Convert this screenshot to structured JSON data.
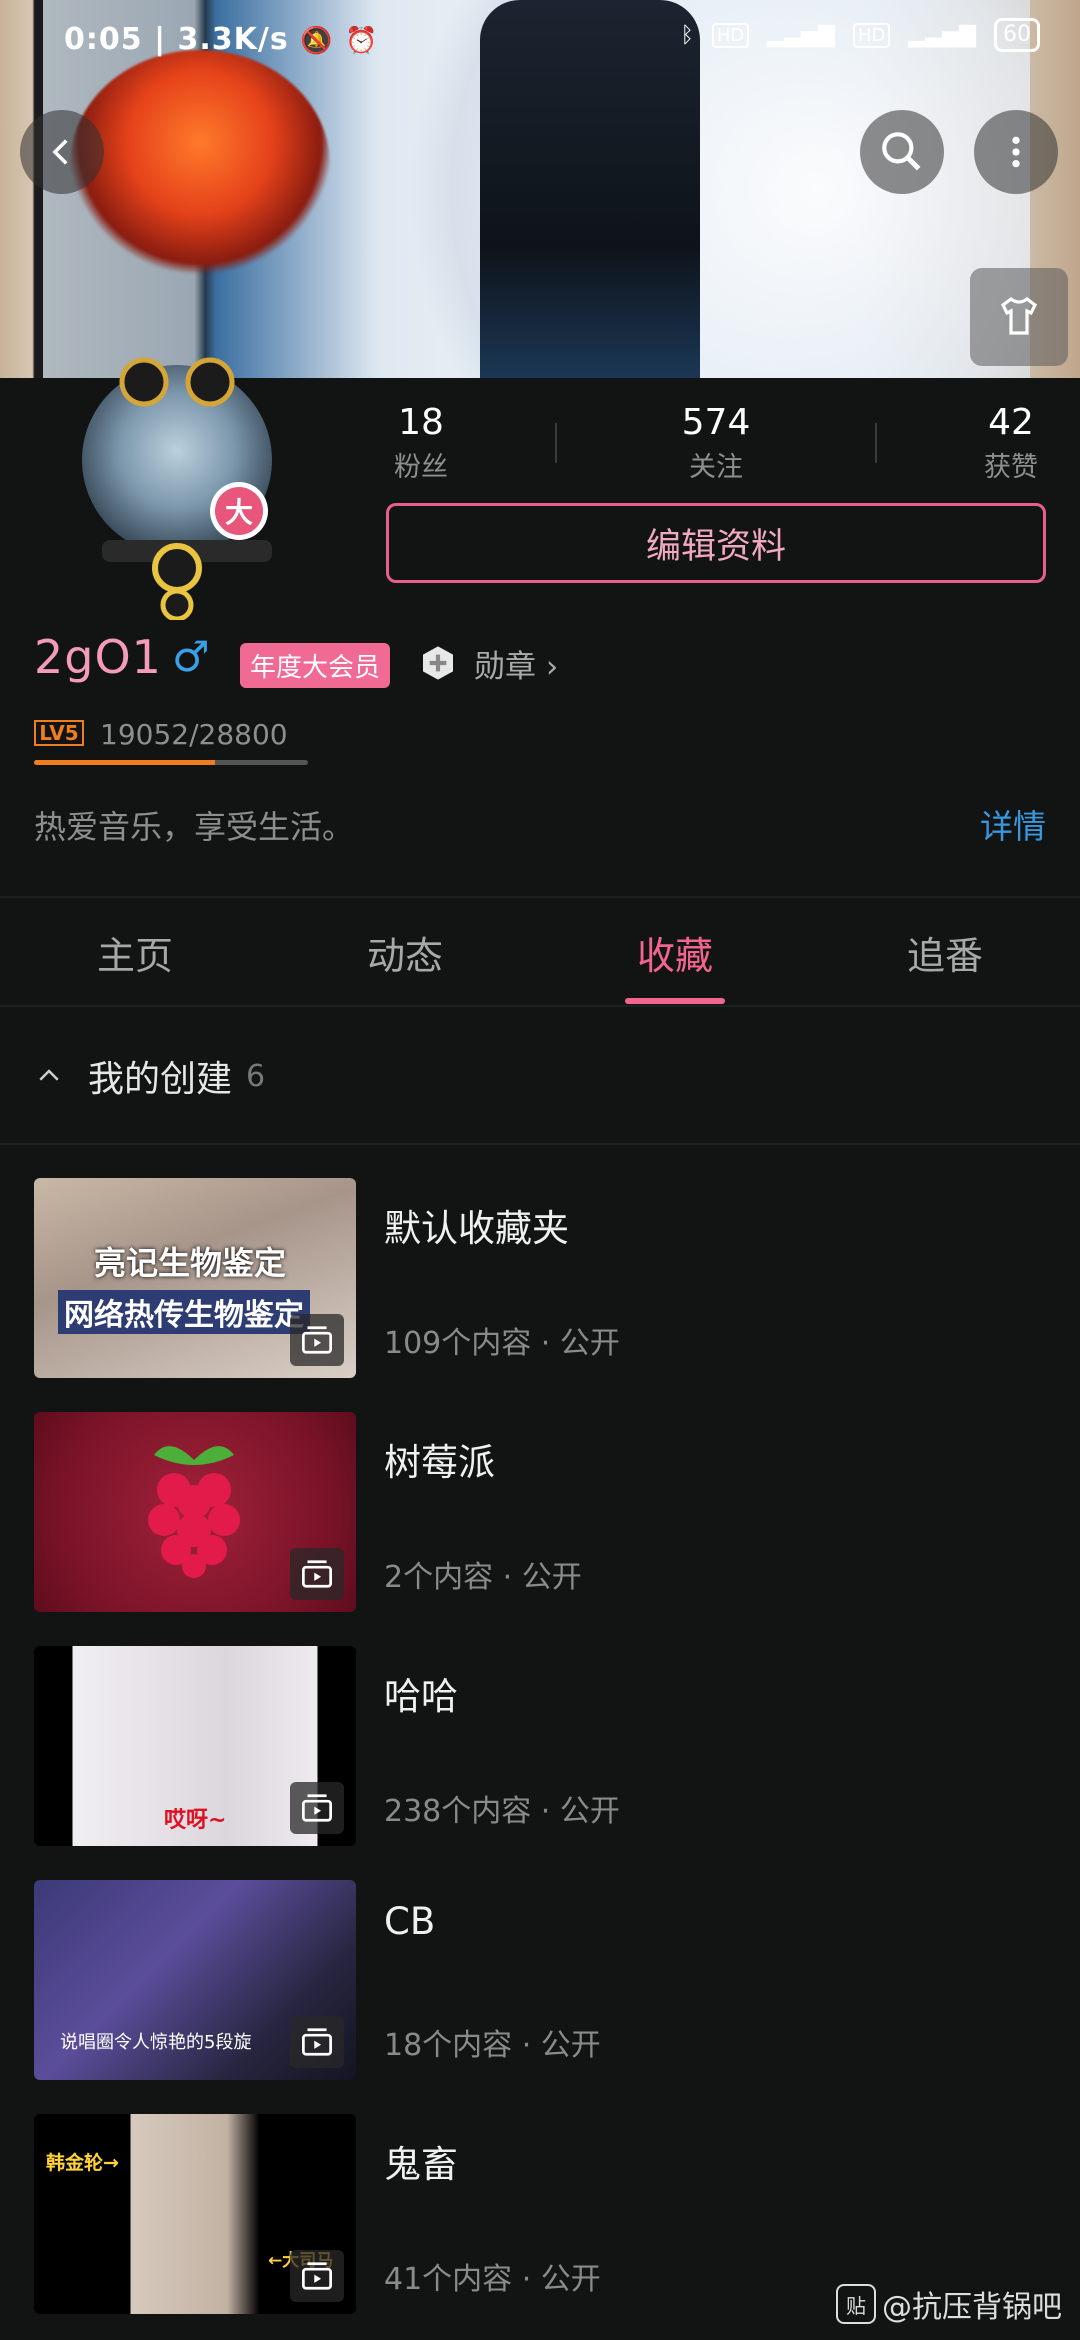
{
  "status": {
    "time": "0:05",
    "speed": "3.3K/s",
    "battery": "60"
  },
  "profile": {
    "stats": [
      {
        "value": "18",
        "label": "粉丝"
      },
      {
        "value": "574",
        "label": "关注"
      },
      {
        "value": "42",
        "label": "获赞"
      }
    ],
    "edit_label": "编辑资料",
    "name": "2gO1",
    "gender_symbol": "♂",
    "vip_label": "年度大会员",
    "medal_label": "勋章 ›",
    "level": "LV5",
    "exp_text": "19052/28800",
    "exp_fraction": 0.66,
    "bio": "热爱音乐，享受生活。",
    "details_label": "详情",
    "avatar_badge": "大"
  },
  "tabs": [
    "主页",
    "动态",
    "收藏",
    "追番"
  ],
  "active_tab": 2,
  "section": {
    "collapse_icon": "chevron-up-icon",
    "title": "我的创建",
    "count": "6"
  },
  "folders": [
    {
      "title": "默认收藏夹",
      "meta": "109个内容 · 公开",
      "thumb_text": [
        "亮记生物鉴定",
        "网络热传生物鉴定"
      ]
    },
    {
      "title": "树莓派",
      "meta": "2个内容 · 公开"
    },
    {
      "title": "哈哈",
      "meta": "238个内容 · 公开",
      "thumb_text": [
        "哎呀~"
      ]
    },
    {
      "title": "CB",
      "meta": "18个内容 · 公开",
      "thumb_text": [
        "说唱圈令人惊艳的5段旋"
      ]
    },
    {
      "title": "鬼畜",
      "meta": "41个内容 · 公开",
      "thumb_text": [
        "韩金轮→",
        "←大司马"
      ]
    }
  ],
  "watermark": {
    "icon_char": "贴",
    "text": "@抗压背锅吧"
  }
}
